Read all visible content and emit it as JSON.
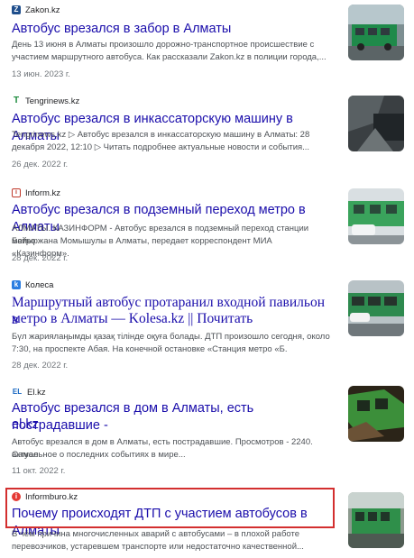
{
  "results": [
    {
      "source": "Zakon.kz",
      "title": "Автобус врезался в забор в Алматы",
      "snippet_1": "День 13 июня в Алматы произошло дорожно-транспортное происшествие с",
      "snippet_2": "участием маршрутного автобуса. Как рассказали Zakon.kz в полиции города,...",
      "date": "13 июн. 2023 г."
    },
    {
      "source": "Tengrinews.kz",
      "title": "Автобус врезался в инкассаторскую машину в Алматы",
      "snippet_1": "Tengrinews.kz ▷ Автобус врезался в инкассаторскую машину в Алматы: 28",
      "snippet_2": "декабря 2022, 12:10 ▷ Читать подробнее актуальные новости и события...",
      "date": "26 дек. 2022 г."
    },
    {
      "source": "Inform.kz",
      "title": "Автобус врезался в подземный переход метро в Алматы",
      "snippet_1": "АЛМАТЫ. КАЗИНФОРМ - Автобус врезался в подземный переход станции метро",
      "snippet_2": "Байыржана Момышулы в Алматы, передает корреспондент МИА «Казинформ».",
      "date": "28 дек. 2022 г."
    },
    {
      "source": "Колеса",
      "title_1": "Маршрутный автобус протаранил входной павильон в",
      "title_2": "метро в Алматы — Kolesa.kz || Почитать",
      "snippet_1": "Бүл жариялаңымды қазақ тілінде оқуға болады. ДТП произошло сегодня, около",
      "snippet_2": "7:30, на проспекте Абая. На конечной остановке «Станция метро «Б.",
      "date": "28 дек. 2022 г."
    },
    {
      "source": "El.kz",
      "title_1": "Автобус врезался в дом в Алматы, есть пострадавшие -",
      "title_2": "el.kz",
      "snippet_1": "Автобус врезался в дом в Алматы, есть пострадавшие. Просмотров - 2240. Самое",
      "snippet_2": "актуальное о последних событиях в мире...",
      "date": "11 окт. 2022 г."
    },
    {
      "source": "Informburo.kz",
      "title": "Почему происходят ДТП с участием автобусов в Алматы",
      "snippet_1": "В чём причина многочисленных аварий с автобусами – в плохой работе",
      "snippet_2": "перевозчиков, устаревшем транспорте или недостаточно качественной..."
    }
  ],
  "colors": {
    "link": "#1a0dab",
    "highlight_border": "#d32f2f"
  }
}
